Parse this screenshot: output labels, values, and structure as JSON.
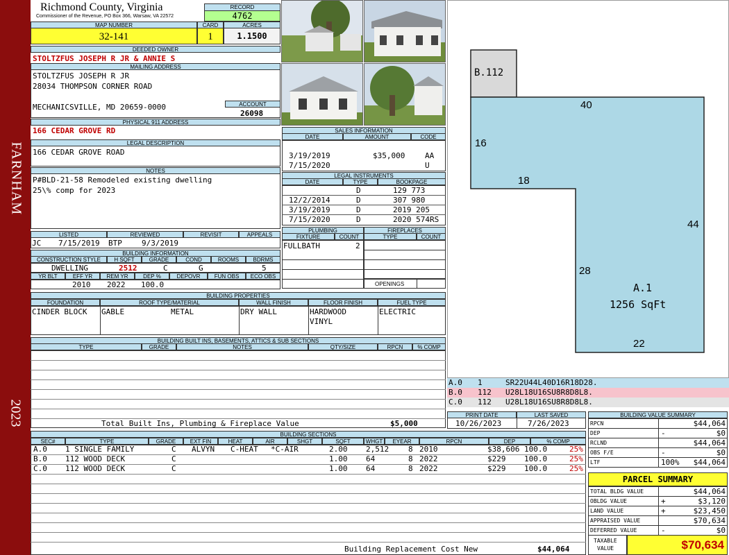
{
  "district": "FARNHAM",
  "year": "2023",
  "county_title": "Richmond County, Virginia",
  "county_sub": "Commissioner of the Revenue, PO Box 366, Warsaw, VA 22572",
  "record": {
    "label": "RECORD",
    "value": "4762"
  },
  "map": {
    "label": "MAP NUMBER",
    "value": "32-141"
  },
  "card": {
    "label": "CARD",
    "value": "1"
  },
  "acres": {
    "label": "ACRES",
    "value": "1.1500"
  },
  "owner": {
    "label": "DEEDED OWNER",
    "value": "STOLTZFUS JOSEPH R JR & ANNIE S"
  },
  "mailing": {
    "label": "MAILING ADDRESS",
    "line1": "STOLTZFUS JOSEPH R JR",
    "line2": "28034 THOMPSON CORNER ROAD",
    "line3": "MECHANICSVILLE, MD 20659-0000"
  },
  "account": {
    "label": "ACCOUNT",
    "value": "26098"
  },
  "physical": {
    "label": "PHYSICAL 911 ADDRESS",
    "value": "166 CEDAR GROVE RD"
  },
  "legal": {
    "label": "LEGAL DESCRIPTION",
    "value": "166 CEDAR GROVE ROAD"
  },
  "notes": {
    "label": "NOTES",
    "line1": "P#BLD-21-58 Remodeled existing dwelling",
    "line2": "25\\% comp for 2023"
  },
  "sales": {
    "label": "SALES INFORMATION",
    "headers": [
      "DATE",
      "AMOUNT",
      "CODE"
    ],
    "rows": [
      {
        "date": "",
        "amount": "",
        "code": ""
      },
      {
        "date": "3/19/2019",
        "amount": "$35,000",
        "code": "AA"
      },
      {
        "date": "7/15/2020",
        "amount": "",
        "code": "U"
      }
    ]
  },
  "legal_instruments": {
    "label": "LEGAL INSTRUMENTS",
    "headers": [
      "DATE",
      "TYPE",
      "BOOKPAGE"
    ],
    "rows": [
      {
        "date": "",
        "type": "D",
        "book": "129 773"
      },
      {
        "date": "12/2/2014",
        "type": "D",
        "book": "307 980"
      },
      {
        "date": "3/19/2019",
        "type": "D",
        "book": "2019 205"
      },
      {
        "date": "7/15/2020",
        "type": "D",
        "book": "2020 574RS"
      }
    ]
  },
  "listed": {
    "label_listed": "LISTED",
    "label_reviewed": "REVIEWED",
    "label_revisit": "REVISIT",
    "label_appeals": "APPEALS",
    "listed_by": "JC",
    "listed_date": "7/15/2019",
    "reviewed_by": "BTP",
    "reviewed_date": "9/3/2019"
  },
  "plumbing": {
    "label": "PLUMBING",
    "fixture_hdr": "FIXTURE",
    "count_hdr": "COUNT",
    "fixture": "FULLBATH",
    "count": "2"
  },
  "fireplaces": {
    "label": "FIREPLACES",
    "type_hdr": "TYPE",
    "count_hdr": "COUNT",
    "openings": "OPENINGS"
  },
  "building_info": {
    "label": "BUILDING INFORMATION",
    "headers1": [
      "CONSTRUCTION STYLE",
      "H SQFT",
      "GRADE",
      "COND",
      "ROOMS",
      "BDRMS"
    ],
    "style": "DWELLING",
    "hsqft": "2512",
    "grade": "C",
    "cond": "G",
    "rooms": "",
    "bdrms": "5",
    "headers2": [
      "YR BLT",
      "EFF YR",
      "REM YR",
      "DEP %",
      "DEPOVR",
      "FUN OBS",
      "ECO OBS"
    ],
    "yrblt": "",
    "effyr": "2010",
    "remyr": "2022",
    "dep": "100.0"
  },
  "building_props": {
    "label": "BUILDING PROPERTIES",
    "headers": [
      "FOUNDATION",
      "ROOF TYPE/MATERIAL",
      "WALL FINISH",
      "FLOOR FINISH",
      "FUEL TYPE"
    ],
    "foundation": "CINDER BLOCK",
    "roof_type": "GABLE",
    "roof_material": "METAL",
    "wall": "DRY WALL",
    "floor1": "HARDWOOD",
    "floor2": "VINYL",
    "fuel": "ELECTRIC"
  },
  "builtins": {
    "label": "BUILDING BUILT INS, BASEMENTS, ATTICS & SUB SECTIONS",
    "headers": [
      "TYPE",
      "GRADE",
      "NOTES",
      "QTY/SIZE",
      "RPCN",
      "% COMP"
    ],
    "total_label": "Total Built Ins, Plumbing & Fireplace Value",
    "total_value": "$5,000"
  },
  "sketch": {
    "b_label": "B.112",
    "a_label": "A.1",
    "a_area": "1256 SqFt",
    "dims": [
      "40",
      "16",
      "18",
      "44",
      "28",
      "22"
    ]
  },
  "vectors": [
    {
      "sec": "A.0",
      "num": "1",
      "code": "SR22U44L40D16R18D28.",
      "color": "#bfe0ef"
    },
    {
      "sec": "B.0",
      "num": "112",
      "code": "U28L18U16SU8R8D8L8.",
      "color": "#f7c3cc"
    },
    {
      "sec": "C.0",
      "num": "112",
      "code": "U28L18U16SU8R8D8L8.",
      "color": "#e4e4e4"
    }
  ],
  "dates": {
    "print_label": "PRINT DATE",
    "print": "10/26/2023",
    "saved_label": "LAST SAVED",
    "saved": "7/26/2023"
  },
  "sections": {
    "label": "BUILDING SECTIONS",
    "headers": [
      "SEC#",
      "TYPE",
      "GRADE",
      "EXT FIN",
      "HEAT",
      "AIR",
      "SHGT",
      "SQFT",
      "WHGT",
      "EYEAR",
      "RPCN",
      "DEP",
      "% COMP"
    ],
    "rows": [
      {
        "sec": "A.0",
        "type": "1 SINGLE FAMILY",
        "grade": "C",
        "ext": "ALVYN",
        "heat": "C-HEAT",
        "air": "*C-AIR",
        "shgt": "2.00",
        "sqft": "2,512",
        "whgt": "8",
        "eyear": "2010",
        "rpcn": "$38,606",
        "dep": "100.0",
        "comp": "25%"
      },
      {
        "sec": "B.0",
        "type": "112 WOOD DECK",
        "grade": "C",
        "ext": "",
        "heat": "",
        "air": "",
        "shgt": "1.00",
        "sqft": "64",
        "whgt": "8",
        "eyear": "2022",
        "rpcn": "$229",
        "dep": "100.0",
        "comp": "25%"
      },
      {
        "sec": "C.0",
        "type": "112 WOOD DECK",
        "grade": "C",
        "ext": "",
        "heat": "",
        "air": "",
        "shgt": "1.00",
        "sqft": "64",
        "whgt": "8",
        "eyear": "2022",
        "rpcn": "$229",
        "dep": "100.0",
        "comp": "25%"
      }
    ],
    "replacement_label": "Building Replacement Cost New",
    "replacement_value": "$44,064"
  },
  "value_summary": {
    "label": "BUILDING VALUE SUMMARY",
    "rows": [
      {
        "k": "RPCN",
        "sign": "",
        "v": "$44,064"
      },
      {
        "k": "DEP",
        "sign": "-",
        "v": "$0"
      },
      {
        "k": "RCLND",
        "sign": "",
        "v": "$44,064"
      },
      {
        "k": "OBS F/E",
        "sign": "-",
        "v": "$0"
      },
      {
        "k": "LTF",
        "sign": "100%",
        "v": "$44,064"
      }
    ]
  },
  "parcel": {
    "label": "PARCEL SUMMARY",
    "rows": [
      {
        "k": "TOTAL BLDG VALUE",
        "sign": "",
        "v": "$44,064"
      },
      {
        "k": "OBLDG VALUE",
        "sign": "+",
        "v": "$3,120"
      },
      {
        "k": "LAND VALUE",
        "sign": "+",
        "v": "$23,450"
      },
      {
        "k": "APPRAISED VALUE",
        "sign": "",
        "v": "$70,634"
      },
      {
        "k": "DEFERRED VALUE",
        "sign": "-",
        "v": "$0"
      }
    ],
    "taxable_label1": "TAXABLE",
    "taxable_label2": "VALUE",
    "taxable_value": "$70,634"
  }
}
